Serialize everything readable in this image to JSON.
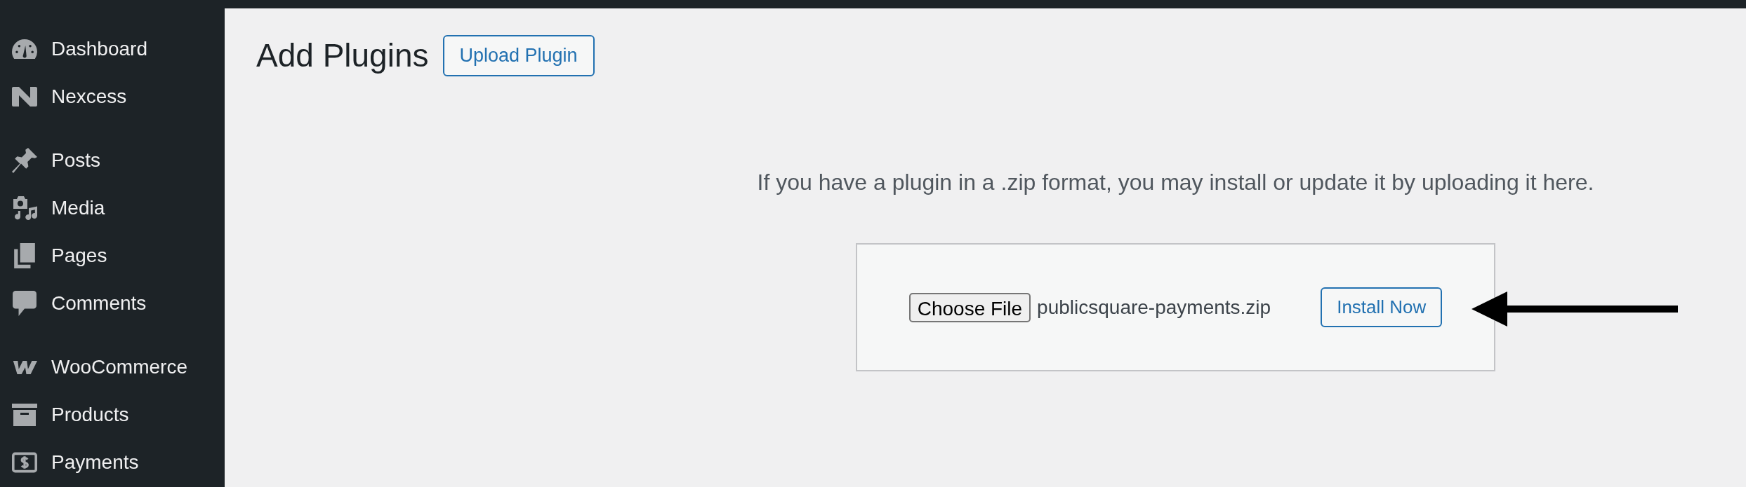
{
  "sidebar": {
    "sections": [
      {
        "items": [
          {
            "label": "Dashboard"
          },
          {
            "label": "Nexcess"
          }
        ]
      },
      {
        "items": [
          {
            "label": "Posts"
          },
          {
            "label": "Media"
          },
          {
            "label": "Pages"
          },
          {
            "label": "Comments"
          }
        ]
      },
      {
        "items": [
          {
            "label": "WooCommerce"
          },
          {
            "label": "Products"
          },
          {
            "label": "Payments"
          }
        ]
      }
    ]
  },
  "page": {
    "title": "Add Plugins",
    "title_button": "Upload Plugin"
  },
  "upload": {
    "instructions": "If you have a plugin in a .zip format, you may install or update it by uploading it here.",
    "choose_file_button": "Choose File",
    "file_name": "publicsquare-payments.zip",
    "install_button": "Install Now"
  }
}
